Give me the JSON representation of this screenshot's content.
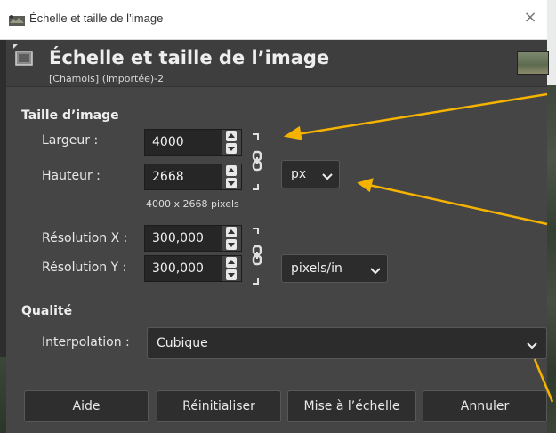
{
  "window": {
    "title": "Échelle et taille de l’image",
    "close_glyph": "×"
  },
  "header": {
    "title": "Échelle et taille de l’image",
    "subtitle": "[Chamois] (importée)-2"
  },
  "image_size": {
    "section_label": "Taille d’image",
    "width_label": "Largeur :",
    "width_value": "4000",
    "height_label": "Hauteur :",
    "height_value": "2668",
    "unit": "px",
    "pixel_summary": "4000 x 2668 pixels",
    "res_x_label": "Résolution X :",
    "res_x_value": "300,000",
    "res_y_label": "Résolution Y :",
    "res_y_value": "300,000",
    "res_unit": "pixels/in"
  },
  "quality": {
    "section_label": "Qualité",
    "interpolation_label": "Interpolation :",
    "interpolation_value": "Cubique"
  },
  "buttons": {
    "help": "Aide",
    "reset": "Réinitialiser",
    "scale": "Mise à l’échelle",
    "cancel": "Annuler"
  },
  "colors": {
    "annotation_arrow": "#f5b300",
    "dialog_bg": "#454545"
  },
  "icons": [
    "gimp-app-icon",
    "scale-image-icon",
    "chain-link-icon",
    "chevron-down-icon",
    "close-icon"
  ]
}
